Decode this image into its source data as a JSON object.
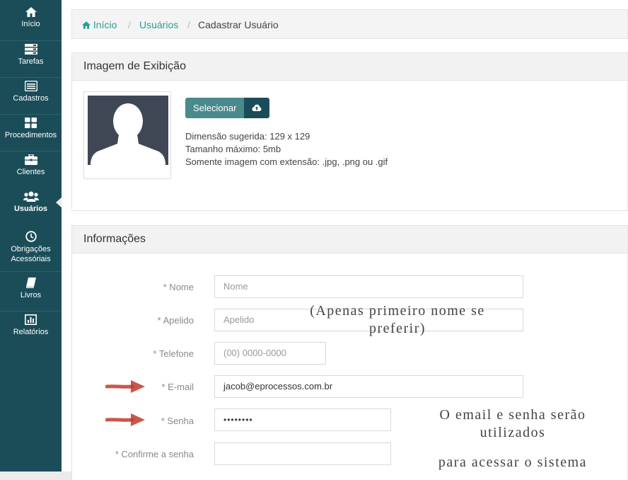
{
  "sidebar": {
    "items": [
      {
        "label": "Início",
        "icon": "home-icon"
      },
      {
        "label": "Tarefas",
        "icon": "tasks-icon"
      },
      {
        "label": "Cadastros",
        "icon": "list-icon"
      },
      {
        "label": "Procedimentos",
        "icon": "grid-icon"
      },
      {
        "label": "Clientes",
        "icon": "briefcase-icon"
      },
      {
        "label": "Usuários",
        "icon": "users-icon",
        "active": true
      },
      {
        "label": "Obrigações",
        "label2": "Acessóriais",
        "icon": "clock-icon"
      },
      {
        "label": "Livros",
        "icon": "book-icon"
      },
      {
        "label": "Relatórios",
        "icon": "chart-icon"
      }
    ]
  },
  "breadcrumb": {
    "home": "Início",
    "section": "Usuários",
    "current": "Cadastrar Usuário",
    "separator": "/"
  },
  "image_panel": {
    "title": "Imagem de Exibição",
    "select_label": "Selecionar",
    "hint_dimension": "Dimensão sugerida: 129 x 129",
    "hint_size": "Tamanho máximo: 5mb",
    "hint_ext": "Somente imagem com extensão: .jpg, .png ou .gif"
  },
  "info_panel": {
    "title": "Informações",
    "fields": {
      "nome": {
        "label": "* Nome",
        "placeholder": "Nome"
      },
      "apelido": {
        "label": "* Apelido",
        "placeholder": "Apelido"
      },
      "telefone": {
        "label": "* Telefone",
        "placeholder": "(00) 0000-0000"
      },
      "email": {
        "label": "* E-mail",
        "value": "jacob@eprocessos.com.br"
      },
      "senha": {
        "label": "* Senha",
        "value": "••••••••"
      },
      "confirme": {
        "label": "* Confirme a senha",
        "value": ""
      }
    }
  },
  "annotations": {
    "apelido_note_1": "(Apenas primeiro nome se",
    "apelido_note_2": "preferir)",
    "login_note_1": "O email e senha serão",
    "login_note_2": "utilizados",
    "login_note_3": "para acessar o sistema"
  },
  "colors": {
    "sidebar": "#1b4d59",
    "accent": "#2a9d95",
    "select_button": "#4a8a8c",
    "arrow": "#c0392b"
  }
}
